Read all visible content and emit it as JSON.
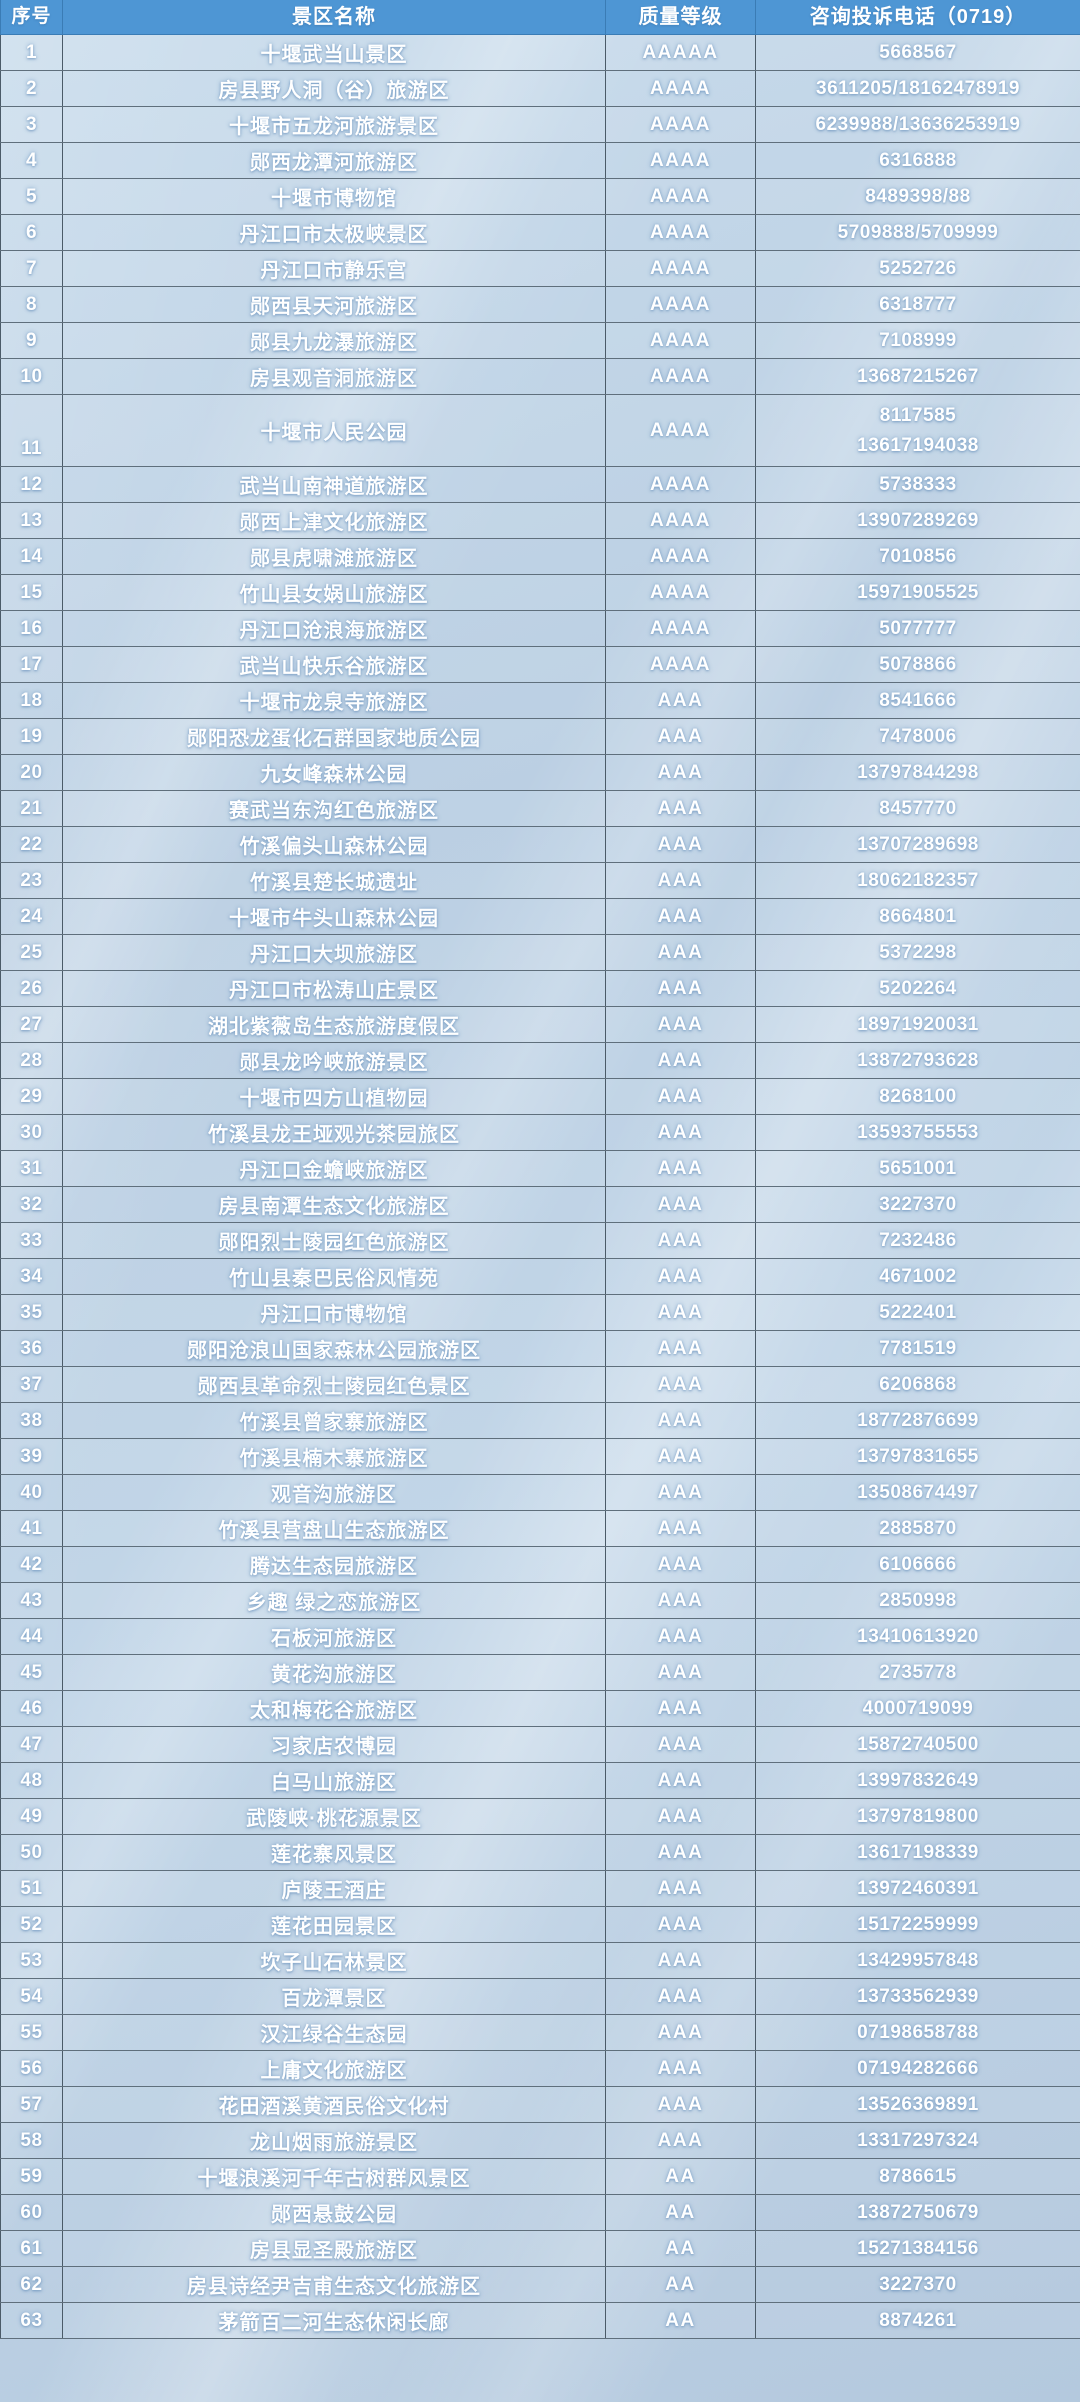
{
  "table": {
    "headers": {
      "index": "序号",
      "name": "景区名称",
      "level": "质量等级",
      "phone": "咨询投诉电话（0719）"
    },
    "colors": {
      "header_background": "#4e96d4",
      "header_text": "#ffffff",
      "body_text": "#ffffff",
      "page_background": "#bcd2e4",
      "grid_line": "#5f6f7c"
    },
    "rows": [
      {
        "index": "1",
        "name": "十堰武当山景区",
        "level": "AAAAA",
        "phone": "5668567"
      },
      {
        "index": "2",
        "name": "房县野人洞（谷）旅游区",
        "level": "AAAA",
        "phone": "3611205/18162478919"
      },
      {
        "index": "3",
        "name": "十堰市五龙河旅游景区",
        "level": "AAAA",
        "phone": "6239988/13636253919"
      },
      {
        "index": "4",
        "name": "郧西龙潭河旅游区",
        "level": "AAAA",
        "phone": "6316888"
      },
      {
        "index": "5",
        "name": "十堰市博物馆",
        "level": "AAAA",
        "phone": "8489398/88"
      },
      {
        "index": "6",
        "name": "丹江口市太极峡景区",
        "level": "AAAA",
        "phone": "5709888/5709999"
      },
      {
        "index": "7",
        "name": "丹江口市静乐宫",
        "level": "AAAA",
        "phone": "5252726"
      },
      {
        "index": "8",
        "name": "郧西县天河旅游区",
        "level": "AAAA",
        "phone": "6318777"
      },
      {
        "index": "9",
        "name": "郧县九龙瀑旅游区",
        "level": "AAAA",
        "phone": "7108999"
      },
      {
        "index": "10",
        "name": "房县观音洞旅游区",
        "level": "AAAA",
        "phone": "13687215267"
      },
      {
        "index": "11",
        "name": "十堰市人民公园",
        "level": "AAAA",
        "phone": "8117585",
        "phone2": "13617194038",
        "tall": true
      },
      {
        "index": "12",
        "name": "武当山南神道旅游区",
        "level": "AAAA",
        "phone": "5738333"
      },
      {
        "index": "13",
        "name": "郧西上津文化旅游区",
        "level": "AAAA",
        "phone": "13907289269"
      },
      {
        "index": "14",
        "name": "郧县虎啸滩旅游区",
        "level": "AAAA",
        "phone": "7010856"
      },
      {
        "index": "15",
        "name": "竹山县女娲山旅游区",
        "level": "AAAA",
        "phone": "15971905525"
      },
      {
        "index": "16",
        "name": "丹江口沧浪海旅游区",
        "level": "AAAA",
        "phone": "5077777"
      },
      {
        "index": "17",
        "name": "武当山快乐谷旅游区",
        "level": "AAAA",
        "phone": "5078866"
      },
      {
        "index": "18",
        "name": "十堰市龙泉寺旅游区",
        "level": "AAA",
        "phone": "8541666"
      },
      {
        "index": "19",
        "name": "郧阳恐龙蛋化石群国家地质公园",
        "level": "AAA",
        "phone": "7478006"
      },
      {
        "index": "20",
        "name": "九女峰森林公园",
        "level": "AAA",
        "phone": "13797844298"
      },
      {
        "index": "21",
        "name": "赛武当东沟红色旅游区",
        "level": "AAA",
        "phone": "8457770"
      },
      {
        "index": "22",
        "name": "竹溪偏头山森林公园",
        "level": "AAA",
        "phone": "13707289698"
      },
      {
        "index": "23",
        "name": "竹溪县楚长城遗址",
        "level": "AAA",
        "phone": "18062182357"
      },
      {
        "index": "24",
        "name": "十堰市牛头山森林公园",
        "level": "AAA",
        "phone": "8664801"
      },
      {
        "index": "25",
        "name": "丹江口大坝旅游区",
        "level": "AAA",
        "phone": "5372298"
      },
      {
        "index": "26",
        "name": "丹江口市松涛山庄景区",
        "level": "AAA",
        "phone": "5202264"
      },
      {
        "index": "27",
        "name": "湖北紫薇岛生态旅游度假区",
        "level": "AAA",
        "phone": "18971920031"
      },
      {
        "index": "28",
        "name": "郧县龙吟峡旅游景区",
        "level": "AAA",
        "phone": "13872793628"
      },
      {
        "index": "29",
        "name": "十堰市四方山植物园",
        "level": "AAA",
        "phone": "8268100"
      },
      {
        "index": "30",
        "name": "竹溪县龙王垭观光茶园旅区",
        "level": "AAA",
        "phone": "13593755553"
      },
      {
        "index": "31",
        "name": "丹江口金蟾峡旅游区",
        "level": "AAA",
        "phone": "5651001"
      },
      {
        "index": "32",
        "name": "房县南潭生态文化旅游区",
        "level": "AAA",
        "phone": "3227370"
      },
      {
        "index": "33",
        "name": "郧阳烈士陵园红色旅游区",
        "level": "AAA",
        "phone": "7232486"
      },
      {
        "index": "34",
        "name": "竹山县秦巴民俗风情苑",
        "level": "AAA",
        "phone": "4671002"
      },
      {
        "index": "35",
        "name": "丹江口市博物馆",
        "level": "AAA",
        "phone": "5222401"
      },
      {
        "index": "36",
        "name": "郧阳沧浪山国家森林公园旅游区",
        "level": "AAA",
        "phone": "7781519"
      },
      {
        "index": "37",
        "name": "郧西县革命烈士陵园红色景区",
        "level": "AAA",
        "phone": "6206868"
      },
      {
        "index": "38",
        "name": "竹溪县曾家寨旅游区",
        "level": "AAA",
        "phone": "18772876699"
      },
      {
        "index": "39",
        "name": "竹溪县楠木寨旅游区",
        "level": "AAA",
        "phone": "13797831655"
      },
      {
        "index": "40",
        "name": "观音沟旅游区",
        "level": "AAA",
        "phone": "13508674497"
      },
      {
        "index": "41",
        "name": "竹溪县营盘山生态旅游区",
        "level": "AAA",
        "phone": "2885870"
      },
      {
        "index": "42",
        "name": "腾达生态园旅游区",
        "level": "AAA",
        "phone": "6106666"
      },
      {
        "index": "43",
        "name": "乡趣 绿之恋旅游区",
        "level": "AAA",
        "phone": "2850998"
      },
      {
        "index": "44",
        "name": "石板河旅游区",
        "level": "AAA",
        "phone": "13410613920"
      },
      {
        "index": "45",
        "name": "黄花沟旅游区",
        "level": "AAA",
        "phone": "2735778"
      },
      {
        "index": "46",
        "name": "太和梅花谷旅游区",
        "level": "AAA",
        "phone": "4000719099"
      },
      {
        "index": "47",
        "name": "习家店农博园",
        "level": "AAA",
        "phone": "15872740500"
      },
      {
        "index": "48",
        "name": "白马山旅游区",
        "level": "AAA",
        "phone": "13997832649"
      },
      {
        "index": "49",
        "name": "武陵峡·桃花源景区",
        "level": "AAA",
        "phone": "13797819800"
      },
      {
        "index": "50",
        "name": "莲花寨风景区",
        "level": "AAA",
        "phone": "13617198339"
      },
      {
        "index": "51",
        "name": "庐陵王酒庄",
        "level": "AAA",
        "phone": "13972460391"
      },
      {
        "index": "52",
        "name": "莲花田园景区",
        "level": "AAA",
        "phone": "15172259999"
      },
      {
        "index": "53",
        "name": "坎子山石林景区",
        "level": "AAA",
        "phone": "13429957848"
      },
      {
        "index": "54",
        "name": "百龙潭景区",
        "level": "AAA",
        "phone": "13733562939"
      },
      {
        "index": "55",
        "name": "汉江绿谷生态园",
        "level": "AAA",
        "phone": "07198658788"
      },
      {
        "index": "56",
        "name": "上庸文化旅游区",
        "level": "AAA",
        "phone": "07194282666"
      },
      {
        "index": "57",
        "name": "花田酒溪黄酒民俗文化村",
        "level": "AAA",
        "phone": "13526369891"
      },
      {
        "index": "58",
        "name": "龙山烟雨旅游景区",
        "level": "AAA",
        "phone": "13317297324"
      },
      {
        "index": "59",
        "name": "十堰浪溪河千年古树群风景区",
        "level": "AA",
        "phone": "8786615"
      },
      {
        "index": "60",
        "name": "郧西悬鼓公园",
        "level": "AA",
        "phone": "13872750679"
      },
      {
        "index": "61",
        "name": "房县显圣殿旅游区",
        "level": "AA",
        "phone": "15271384156"
      },
      {
        "index": "62",
        "name": "房县诗经尹吉甫生态文化旅游区",
        "level": "AA",
        "phone": "3227370"
      },
      {
        "index": "63",
        "name": "茅箭百二河生态休闲长廊",
        "level": "AA",
        "phone": "8874261"
      }
    ]
  }
}
